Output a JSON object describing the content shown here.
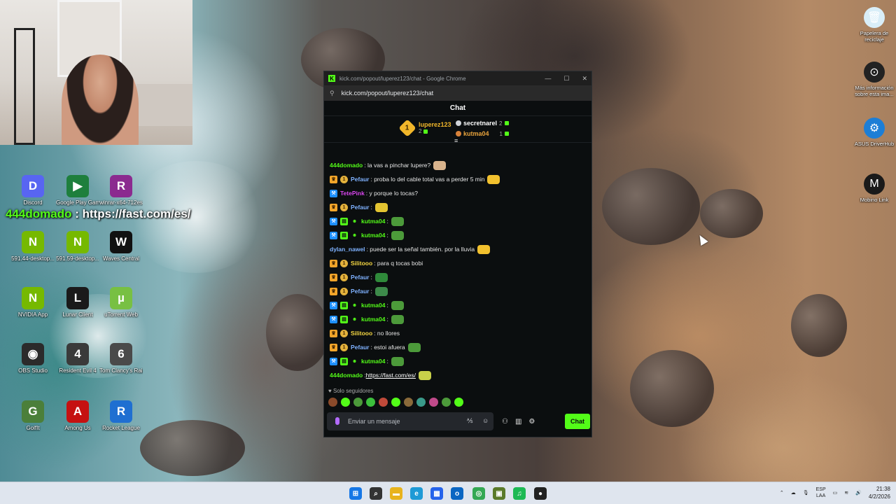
{
  "desktop": {
    "icons_left": [
      {
        "label": "Discord",
        "color": "#5865f2",
        "glyph": "D"
      },
      {
        "label": "Google Play Games",
        "color": "#1e7f3d",
        "glyph": "▶"
      },
      {
        "label": "winrar-x64-712es",
        "color": "#8b2a8f",
        "glyph": "R"
      },
      {
        "label": "591.44-desktop...",
        "color": "#76b900",
        "glyph": "N"
      },
      {
        "label": "591.59-desktop...",
        "color": "#76b900",
        "glyph": "N"
      },
      {
        "label": "Waves Central",
        "color": "#111111",
        "glyph": "W"
      },
      {
        "label": "NVIDIA App",
        "color": "#76b900",
        "glyph": "N"
      },
      {
        "label": "Lunar Client",
        "color": "#1a1a1a",
        "glyph": "L"
      },
      {
        "label": "uTorrent Web",
        "color": "#78c043",
        "glyph": "µ"
      },
      {
        "label": "OBS Studio",
        "color": "#2b2b2b",
        "glyph": "◉"
      },
      {
        "label": "Resident Evil 4",
        "color": "#3a3a3a",
        "glyph": "4"
      },
      {
        "label": "Tom Clancy's Rainbow Six...",
        "color": "#4a4a4a",
        "glyph": "6"
      },
      {
        "label": "GolfIt",
        "color": "#4b7f3a",
        "glyph": "G"
      },
      {
        "label": "Among Us",
        "color": "#c51111",
        "glyph": "A"
      },
      {
        "label": "Rocket League",
        "color": "#1f6fd1",
        "glyph": "R"
      }
    ],
    "icons_right": [
      {
        "label": "Papelera de reciclaje",
        "glyph": "🗑",
        "color": "#d9eef8"
      },
      {
        "label": "Más información sobre esta ima...",
        "glyph": "⊙",
        "color": "#222222"
      },
      {
        "label": "ASUS DriverHub",
        "glyph": "⚙",
        "color": "#1c7ed6"
      },
      {
        "label": "Mobino Link",
        "glyph": "M",
        "color": "#1a1a1a"
      }
    ],
    "overlay_chat": {
      "user": "444domado",
      "sep": " : ",
      "text": "https://fast.com/es/"
    }
  },
  "window": {
    "title": "kick.com/popout/luperez123/chat - Google Chrome",
    "url": "kick.com/popout/luperez123/chat",
    "controls": [
      "—",
      "☐",
      "✕"
    ]
  },
  "chat": {
    "header": "Chat",
    "leaderboard": {
      "first": {
        "rank": "1",
        "name": "luperez123",
        "count": "2"
      },
      "second": {
        "name": "secretnarel",
        "count": "2"
      },
      "third": {
        "name": "kutma04",
        "count": "1"
      }
    },
    "messages": [
      {
        "badges": [],
        "user": "444domado",
        "color": "#53fc18",
        "text": ": la vas a pinchar lupere?",
        "emote": "#d9b38c"
      },
      {
        "badges": [
          "crown",
          "gold"
        ],
        "user": "Pefaur",
        "color": "#7fb2ff",
        "text": ": proba lo del cable total vas a perder 5 min",
        "emote": "#f2c12e"
      },
      {
        "badges": [
          "blue"
        ],
        "user": "TetePink",
        "color": "#d946ef",
        "text": ": y porque lo tocas?",
        "emote": ""
      },
      {
        "badges": [
          "crown",
          "gold"
        ],
        "user": "Pefaur",
        "color": "#7fb2ff",
        "text": ":",
        "emote": "#e3c431"
      },
      {
        "badges": [
          "blue",
          "green",
          "frog"
        ],
        "user": "kutma04",
        "color": "#53fc18",
        "text": ":",
        "emote": "#4c9a3a"
      },
      {
        "badges": [
          "blue",
          "green",
          "frog"
        ],
        "user": "kutma04",
        "color": "#53fc18",
        "text": ":",
        "emote": "#4c9a3a"
      },
      {
        "badges": [],
        "user": "dylan_nawel",
        "color": "#7fb2ff",
        "text": ": puede ser la señal también. por la lluvia",
        "emote": "#f2c12e"
      },
      {
        "badges": [
          "crown",
          "gold"
        ],
        "user": "Silitooo",
        "color": "#f5d742",
        "text": ": para q tocas bobi",
        "emote": ""
      },
      {
        "badges": [
          "crown",
          "gold"
        ],
        "user": "Pefaur",
        "color": "#7fb2ff",
        "text": ":",
        "emote": "#2f8a3a"
      },
      {
        "badges": [
          "crown",
          "gold"
        ],
        "user": "Pefaur",
        "color": "#7fb2ff",
        "text": ":",
        "emote": "#3d8a4a"
      },
      {
        "badges": [
          "blue",
          "green",
          "frog"
        ],
        "user": "kutma04",
        "color": "#53fc18",
        "text": ":",
        "emote": "#4c9a3a"
      },
      {
        "badges": [
          "blue",
          "green",
          "frog"
        ],
        "user": "kutma04",
        "color": "#53fc18",
        "text": ":",
        "emote": "#4c9a3a"
      },
      {
        "badges": [
          "crown",
          "gold"
        ],
        "user": "Silitooo",
        "color": "#f5d742",
        "text": ": no llores",
        "emote": ""
      },
      {
        "badges": [
          "crown",
          "gold"
        ],
        "user": "Pefaur",
        "color": "#7fb2ff",
        "text": ": estoi afuera",
        "emote": "#4c9a3a"
      },
      {
        "badges": [
          "blue",
          "green",
          "frog"
        ],
        "user": "kutma04",
        "color": "#53fc18",
        "text": ":",
        "emote": "#4c9a3a"
      },
      {
        "badges": [],
        "user": "444domado",
        "color": "#53fc18",
        "text": ": ",
        "link": "https://fast.com/es/",
        "emote": "#c9d14a"
      }
    ],
    "followers_only": "Solo seguidores",
    "emote_bar": [
      "#8a4a2a",
      "#53fc18",
      "#4c9a3a",
      "#3cbf3c",
      "#c04a3a",
      "#53fc18",
      "#8a6a3a",
      "#3a9a8a",
      "#c04a8a",
      "#4c9a3a",
      "#53fc18"
    ],
    "input": {
      "placeholder": "Enviar un mensaje",
      "value": ""
    },
    "send_label": "Chat"
  },
  "taskbar": {
    "apps": [
      {
        "name": "start",
        "glyph": "⊞",
        "color": "#1677e6"
      },
      {
        "name": "search",
        "glyph": "⌕",
        "color": "#333333"
      },
      {
        "name": "explorer",
        "glyph": "▬",
        "color": "#e8b31c"
      },
      {
        "name": "edge",
        "glyph": "e",
        "color": "#1e9ad6"
      },
      {
        "name": "store",
        "glyph": "▦",
        "color": "#2563eb"
      },
      {
        "name": "outlook",
        "glyph": "o",
        "color": "#0a66c2"
      },
      {
        "name": "chrome",
        "glyph": "◎",
        "color": "#34a853"
      },
      {
        "name": "minecraft",
        "glyph": "▣",
        "color": "#5a7a2a"
      },
      {
        "name": "spotify",
        "glyph": "♫",
        "color": "#1db954"
      },
      {
        "name": "obs",
        "glyph": "●",
        "color": "#222222"
      }
    ],
    "tray": {
      "lang_top": "ESP",
      "lang_bottom": "LAA",
      "time": "21:38",
      "date": "4/2/2026"
    }
  }
}
